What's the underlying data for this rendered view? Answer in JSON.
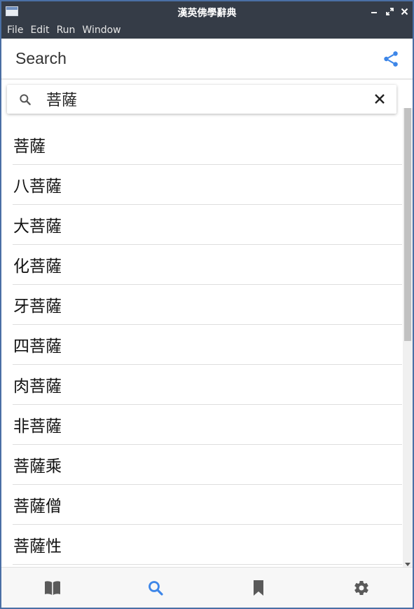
{
  "window": {
    "title": "漢英佛學辭典"
  },
  "menu": {
    "items": [
      "File",
      "Edit",
      "Run",
      "Window"
    ]
  },
  "appbar": {
    "title": "Search",
    "share_icon": "share-icon"
  },
  "search": {
    "value": "菩薩",
    "search_icon": "search-icon",
    "clear_icon": "close-icon"
  },
  "results": [
    "菩薩",
    "八菩薩",
    "大菩薩",
    "化菩薩",
    "牙菩薩",
    "四菩薩",
    "肉菩薩",
    "非菩薩",
    "菩薩乘",
    "菩薩僧",
    "菩薩性"
  ],
  "bottom_nav": {
    "items": [
      {
        "name": "dictionary",
        "icon": "book-icon",
        "active": false
      },
      {
        "name": "search",
        "icon": "search-icon",
        "active": true
      },
      {
        "name": "bookmarks",
        "icon": "bookmark-icon",
        "active": false
      },
      {
        "name": "settings",
        "icon": "gear-icon",
        "active": false
      }
    ]
  },
  "colors": {
    "accent": "#3d86e8",
    "nav_inactive": "#5a5a5a",
    "titlebar": "#353c47"
  }
}
